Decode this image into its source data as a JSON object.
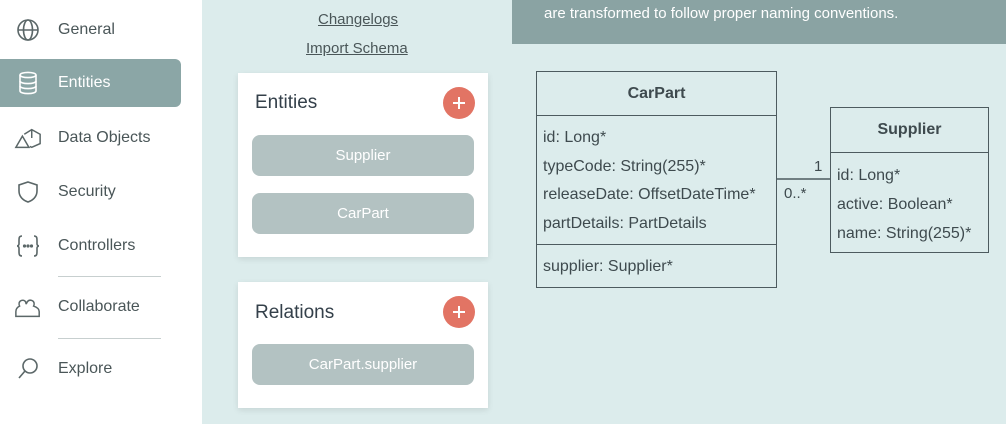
{
  "sidebar": {
    "items": [
      {
        "label": "General",
        "icon": "globe-icon"
      },
      {
        "label": "Entities",
        "icon": "database-icon"
      },
      {
        "label": "Data Objects",
        "icon": "shapes-icon"
      },
      {
        "label": "Security",
        "icon": "shield-icon"
      },
      {
        "label": "Controllers",
        "icon": "braces-icon"
      },
      {
        "label": "Collaborate",
        "icon": "people-icon"
      },
      {
        "label": "Explore",
        "icon": "magnifier-icon"
      }
    ],
    "active": "Entities",
    "active_color": "#8ba6a6"
  },
  "links": {
    "changelogs": "Changelogs",
    "import_schema": "Import Schema"
  },
  "entities_panel": {
    "title": "Entities",
    "add_icon": "plus-icon",
    "items": [
      "Supplier",
      "CarPart"
    ]
  },
  "relations_panel": {
    "title": "Relations",
    "add_icon": "plus-icon",
    "items": [
      "CarPart.supplier"
    ]
  },
  "banner": {
    "text": "are transformed to follow proper naming conventions."
  },
  "diagram": {
    "carpart": {
      "name": "CarPart",
      "attributes": [
        "id: Long*",
        "typeCode: String(255)*",
        "releaseDate: OffsetDateTime*",
        "partDetails: PartDetails"
      ],
      "relations": [
        "supplier: Supplier*"
      ]
    },
    "supplier": {
      "name": "Supplier",
      "attributes": [
        "id: Long*",
        "active: Boolean*",
        "name: String(255)*"
      ]
    },
    "link": {
      "multiplicity_supplier": "1",
      "multiplicity_carpart": "0..*"
    }
  },
  "colors": {
    "accent_add": "#e27464",
    "pill": "#b3c2c2",
    "banner": "#8aa3a3",
    "canvas": "#dcecec"
  }
}
